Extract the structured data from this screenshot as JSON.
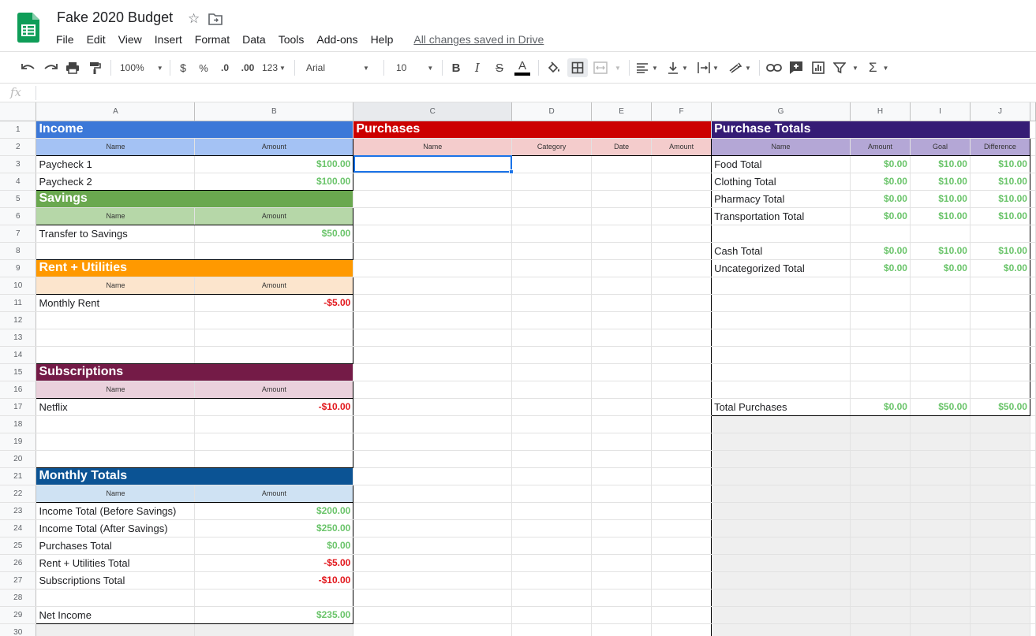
{
  "doc": {
    "title": "Fake 2020 Budget",
    "saved_status": "All changes saved in Drive"
  },
  "menu": [
    "File",
    "Edit",
    "View",
    "Insert",
    "Format",
    "Data",
    "Tools",
    "Add-ons",
    "Help"
  ],
  "toolbar": {
    "zoom": "100%",
    "currency": "$",
    "percent": "%",
    "decrease_decimals": ".0",
    "increase_decimals": ".00",
    "more_formats": "123",
    "font": "Arial",
    "font_size": "10"
  },
  "formula_bar": {
    "label": "fx",
    "value": ""
  },
  "colors": {
    "income": "#3c78d8",
    "income_sub": "#a4c2f4",
    "purchases": "#cc0000",
    "purchases_sub": "#f4cccc",
    "totals": "#351c75",
    "totals_sub": "#b4a7d6",
    "savings": "#6aa84f",
    "savings_sub": "#b6d7a8",
    "rent": "#ff9900",
    "rent_sub": "#fce5cd",
    "subs": "#741b47",
    "subs_sub": "#ead1dc",
    "monthly": "#0b5394",
    "monthly_sub": "#cfe2f3"
  },
  "sheet": {
    "columns": [
      "A",
      "B",
      "C",
      "D",
      "E",
      "F",
      "G",
      "H",
      "I",
      "J"
    ],
    "sub_labels": {
      "name": "Name",
      "amount": "Amount",
      "category": "Category",
      "date": "Date",
      "goal": "Goal",
      "difference": "Difference"
    },
    "income": {
      "title": "Income",
      "rows": [
        {
          "name": "Paycheck 1",
          "amount": "$100.00"
        },
        {
          "name": "Paycheck 2",
          "amount": "$100.00"
        }
      ]
    },
    "purchases": {
      "title": "Purchases"
    },
    "purchase_totals": {
      "title": "Purchase Totals",
      "rows": [
        {
          "name": "Food Total",
          "amount": "$0.00",
          "goal": "$10.00",
          "difference": "$10.00"
        },
        {
          "name": "Clothing Total",
          "amount": "$0.00",
          "goal": "$10.00",
          "difference": "$10.00"
        },
        {
          "name": "Pharmacy Total",
          "amount": "$0.00",
          "goal": "$10.00",
          "difference": "$10.00"
        },
        {
          "name": "Transportation Total",
          "amount": "$0.00",
          "goal": "$10.00",
          "difference": "$10.00"
        },
        {
          "name": "",
          "amount": "",
          "goal": "",
          "difference": ""
        },
        {
          "name": "Cash Total",
          "amount": "$0.00",
          "goal": "$10.00",
          "difference": "$10.00"
        },
        {
          "name": "Uncategorized Total",
          "amount": "$0.00",
          "goal": "$0.00",
          "difference": "$0.00"
        }
      ],
      "total": {
        "name": "Total Purchases",
        "amount": "$0.00",
        "goal": "$50.00",
        "difference": "$50.00"
      }
    },
    "savings": {
      "title": "Savings",
      "rows": [
        {
          "name": "Transfer to Savings",
          "amount": "$50.00"
        }
      ]
    },
    "rent": {
      "title": "Rent + Utilities",
      "rows": [
        {
          "name": "Monthly Rent",
          "amount": "-$5.00"
        }
      ]
    },
    "subscriptions": {
      "title": "Subscriptions",
      "rows": [
        {
          "name": "Netflix",
          "amount": "-$10.00"
        }
      ]
    },
    "monthly_totals": {
      "title": "Monthly Totals",
      "rows": [
        {
          "name": "Income Total (Before Savings)",
          "amount": "$200.00"
        },
        {
          "name": "Income Total (After Savings)",
          "amount": "$250.00"
        },
        {
          "name": "Purchases Total",
          "amount": "$0.00"
        },
        {
          "name": "Rent + Utilities Total",
          "amount": "-$5.00"
        },
        {
          "name": "Subscriptions Total",
          "amount": "-$10.00"
        },
        {
          "name": "",
          "amount": ""
        },
        {
          "name": "Net Income",
          "amount": "$235.00"
        }
      ]
    }
  }
}
